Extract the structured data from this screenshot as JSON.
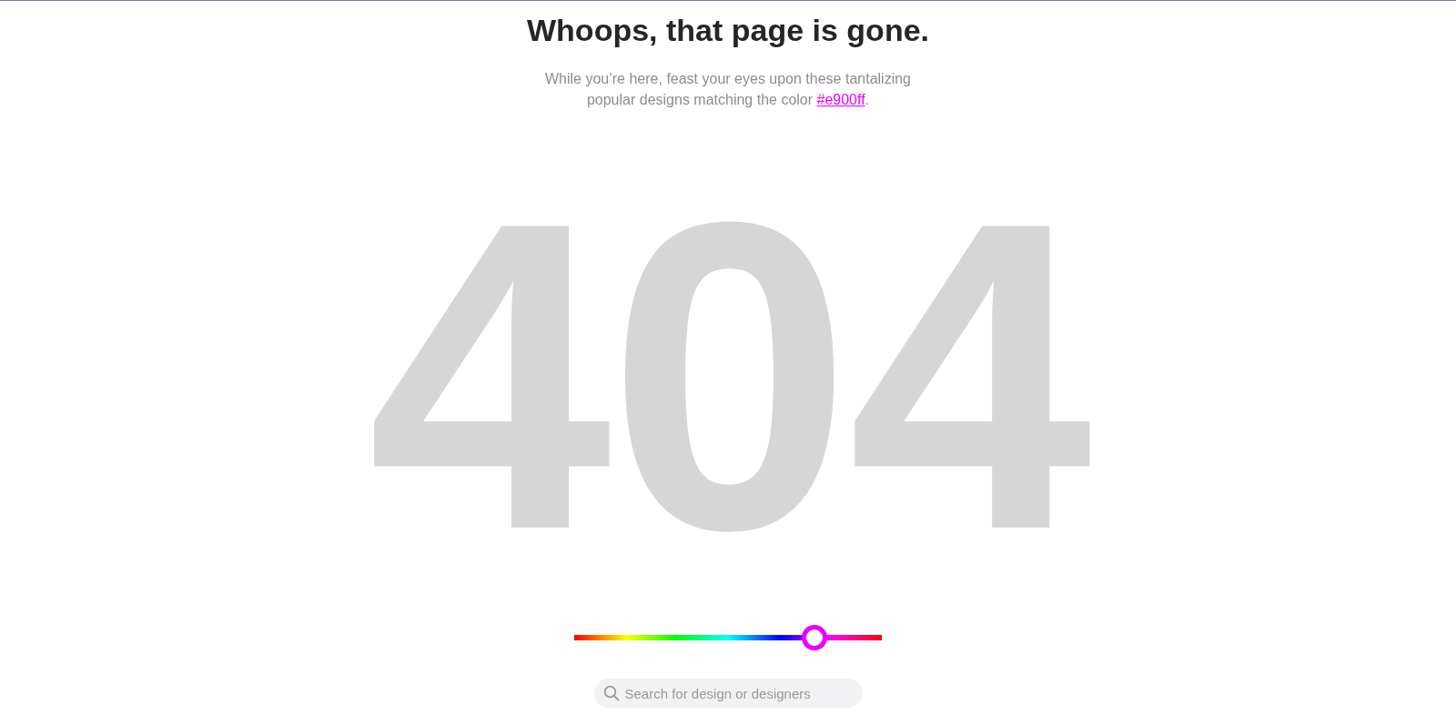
{
  "title": "Whoops, that page is gone.",
  "subtitle": {
    "text": "While you’re here, feast your eyes upon these tantalizing popular designs matching the color ",
    "link": "#e900ff",
    "suffix": "."
  },
  "error_code": "404",
  "hue_slider": {
    "level": 0.78,
    "color": "#e900ff"
  },
  "search": {
    "placeholder": "Search for design or designers"
  }
}
